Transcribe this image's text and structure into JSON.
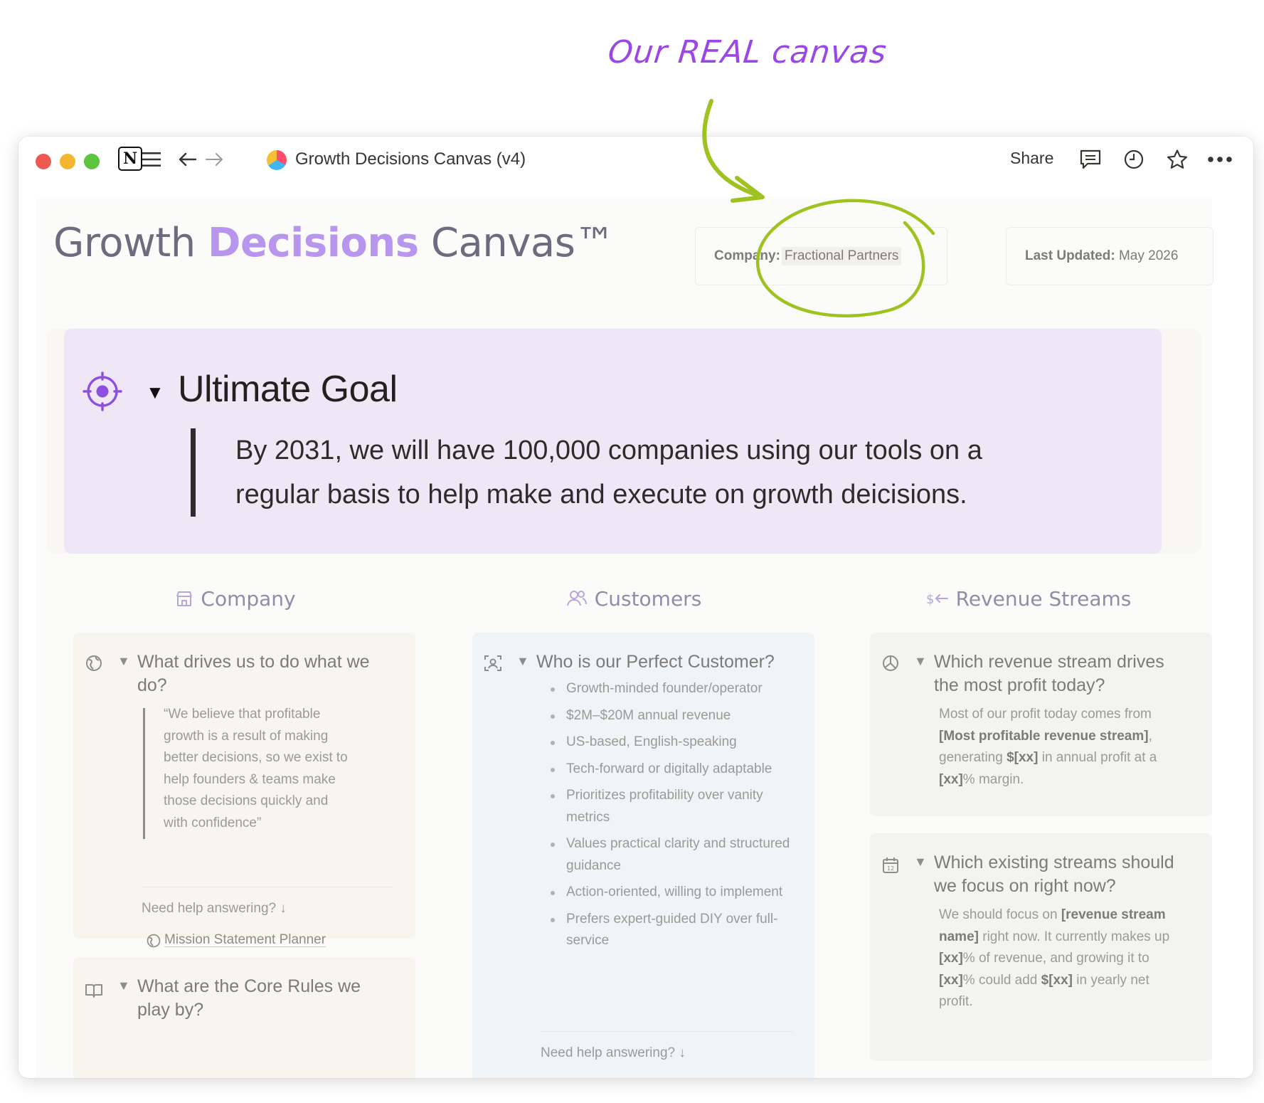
{
  "annotation": {
    "label": "Our REAL canvas",
    "label_color": "#9b46e6",
    "highlight_color": "#9ec21f"
  },
  "window": {
    "breadcrumb_title": "Growth Decisions Canvas (v4)",
    "share_label": "Share",
    "icons": [
      "notion-logo",
      "menu-icon",
      "back-arrow-icon",
      "forward-arrow-icon",
      "comment-icon",
      "history-clock-icon",
      "star-icon",
      "more-dots-icon"
    ]
  },
  "page": {
    "title_part1": "Growth ",
    "title_accent": "Decisions",
    "title_part2": " Canvas™",
    "accent_color": "#b996ed",
    "company_key": "Company:",
    "company_value": "Fractional Partners",
    "updated_key": "Last Updated:",
    "updated_value": "May 2026"
  },
  "goal": {
    "heading": "Ultimate Goal",
    "toggle": "▼",
    "quote_line1": "By 2031, we will have 100,000 companies using our tools on a",
    "quote_line2": "regular basis to help make and execute on growth deicisions."
  },
  "columns": {
    "company": {
      "header": "Company",
      "card1": {
        "question": "What drives us to do what we do?",
        "quote_lines": [
          "“We believe that profitable",
          "growth is a result of making",
          "better decisions, so we exist to",
          "help founders & teams make",
          "those decisions quickly and",
          "with confidence”"
        ],
        "help": "Need help answering? ↓",
        "link": "Mission Statement Planner"
      },
      "card2": {
        "question": "What are the Core Rules we play by?"
      }
    },
    "customers": {
      "header": "Customers",
      "card1": {
        "question": "Who is our Perfect Customer?",
        "bullets": [
          "Growth-minded founder/operator",
          "$2M–$20M annual revenue",
          "US-based, English-speaking",
          "Tech-forward or digitally adaptable",
          "Prioritizes profitability over vanity metrics",
          "Values practical clarity and structured guidance",
          "Action-oriented, willing to implement",
          "Prefers expert-guided DIY over full-service"
        ],
        "help": "Need help answering? ↓"
      }
    },
    "revenue": {
      "header": "Revenue Streams",
      "card1": {
        "question": "Which revenue stream drives the most profit today?",
        "t1": "Most of our profit today comes from",
        "b1": "[Most profitable revenue stream]",
        "t2": ",",
        "t3": "generating",
        "b2": "$[xx]",
        "t4": " in annual profit at a",
        "b3": "[xx]",
        "t5": "% margin."
      },
      "card2": {
        "question": "Which existing streams should we focus on right now?",
        "t1": "We should focus on ",
        "b1": "[revenue stream",
        "b2": "name]",
        "t2": " right now. It currently makes up",
        "b3": "[xx]",
        "t3": "% of revenue, and growing it to",
        "b4": "[xx]",
        "t4": "% could add ",
        "b5": "$[xx]",
        "t5": " in yearly net",
        "t6": "profit."
      }
    }
  }
}
